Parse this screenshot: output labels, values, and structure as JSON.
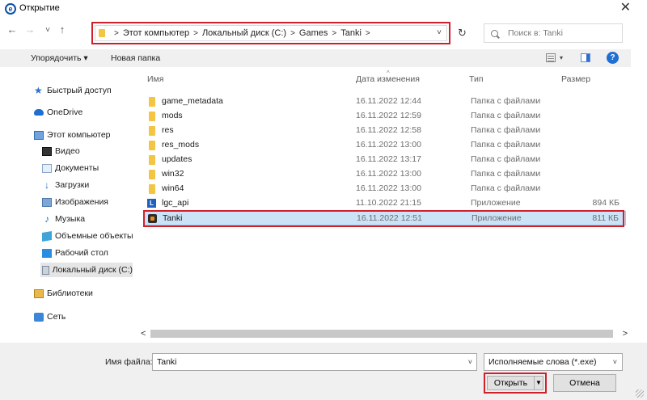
{
  "window": {
    "title": "Открытие",
    "app_icon": "e"
  },
  "nav": {
    "back": "←",
    "forward": "→",
    "history": "˅",
    "up": "↑",
    "breadcrumb": [
      "Этот компьютер",
      "Локальный диск (C:)",
      "Games",
      "Tanki"
    ],
    "refresh": "↻",
    "search_placeholder": "Поиск в: Tanki"
  },
  "toolbar": {
    "organize": "Упорядочить ▾",
    "new_folder": "Новая папка",
    "help": "?"
  },
  "sidebar": {
    "items": [
      {
        "label": "Быстрый доступ",
        "icon": "star-icon"
      },
      {
        "label": "OneDrive",
        "icon": "cloud-icon"
      },
      {
        "label": "Этот компьютер",
        "icon": "computer-icon"
      },
      {
        "label": "Видео",
        "icon": "video-icon"
      },
      {
        "label": "Документы",
        "icon": "documents-icon"
      },
      {
        "label": "Загрузки",
        "icon": "downloads-icon"
      },
      {
        "label": "Изображения",
        "icon": "images-icon"
      },
      {
        "label": "Музыка",
        "icon": "music-icon"
      },
      {
        "label": "Объемные объекты",
        "icon": "3d-objects-icon"
      },
      {
        "label": "Рабочий стол",
        "icon": "desktop-icon"
      },
      {
        "label": "Локальный диск (C:)",
        "icon": "disk-icon"
      },
      {
        "label": "Библиотеки",
        "icon": "libraries-icon"
      },
      {
        "label": "Сеть",
        "icon": "network-icon"
      }
    ]
  },
  "columns": {
    "name": "Имя",
    "date": "Дата изменения",
    "type": "Тип",
    "size": "Размер"
  },
  "files": [
    {
      "name": "game_metadata",
      "date": "16.11.2022 12:44",
      "type": "Папка с файлами",
      "size": "",
      "icon": "folder-icon"
    },
    {
      "name": "mods",
      "date": "16.11.2022 12:59",
      "type": "Папка с файлами",
      "size": "",
      "icon": "folder-icon"
    },
    {
      "name": "res",
      "date": "16.11.2022 12:58",
      "type": "Папка с файлами",
      "size": "",
      "icon": "folder-icon"
    },
    {
      "name": "res_mods",
      "date": "16.11.2022 13:00",
      "type": "Папка с файлами",
      "size": "",
      "icon": "folder-icon"
    },
    {
      "name": "updates",
      "date": "16.11.2022 13:17",
      "type": "Папка с файлами",
      "size": "",
      "icon": "folder-icon"
    },
    {
      "name": "win32",
      "date": "16.11.2022 13:00",
      "type": "Папка с файлами",
      "size": "",
      "icon": "folder-icon"
    },
    {
      "name": "win64",
      "date": "16.11.2022 13:00",
      "type": "Папка с файлами",
      "size": "",
      "icon": "folder-icon"
    },
    {
      "name": "lgc_api",
      "date": "11.10.2022 21:15",
      "type": "Приложение",
      "size": "894 КБ",
      "icon": "lgc-app-icon"
    },
    {
      "name": "Tanki",
      "date": "16.11.2022 12:51",
      "type": "Приложение",
      "size": "811 КБ",
      "icon": "tanki-app-icon"
    }
  ],
  "selected_file": "Tanki",
  "bottom": {
    "filename_label": "Имя файла:",
    "filename_value": "Tanki",
    "filter_value": "Исполняемые слова (*.exe)",
    "open_label": "Открыть",
    "cancel_label": "Отмена"
  },
  "colors": {
    "highlight_red": "#d0212b",
    "selection_blue": "#cce3f7",
    "accent_blue": "#1f6fd2"
  }
}
